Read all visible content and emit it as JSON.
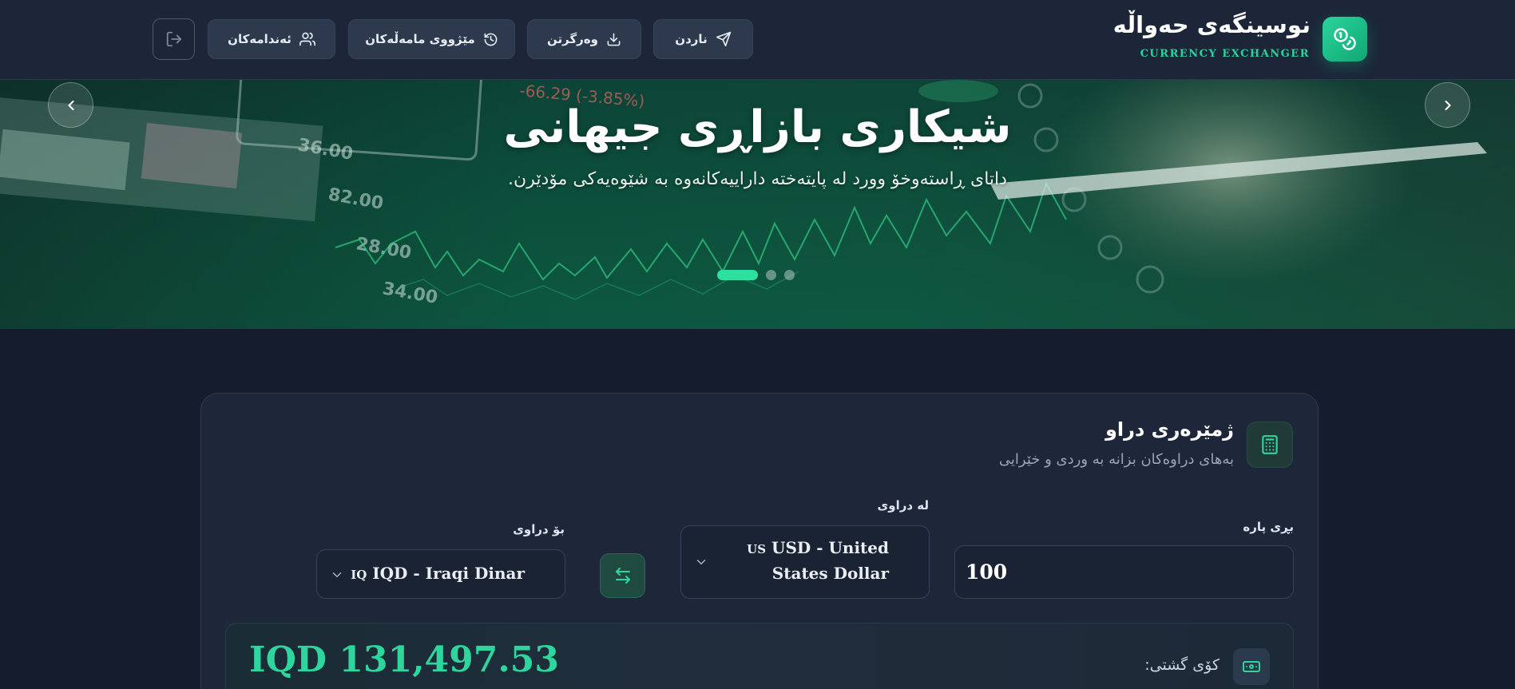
{
  "header": {
    "brand_title": "نوسینگەی حەواڵە",
    "brand_subtitle": "CURRENCY EXCHANGER",
    "nav": {
      "send": "ناردن",
      "receive": "وەرگرتن",
      "history": "مێژووی مامەڵەکان",
      "members": "ئەندامەکان"
    }
  },
  "hero": {
    "title": "شیکاری بازاڕی جیهانی",
    "subtitle": "داتای ڕاستەوخۆ وورد لە پایتەختە داراییەکانەوە بە شێوەیەکی مۆدێرن.",
    "slides": 3,
    "active_slide": 1
  },
  "converter": {
    "title": "ژمێرەری دراو",
    "subtitle": "بەهای دراوەکان بزانە بە وردی و خێرایی",
    "amount_label": "بڕی پارە",
    "amount_value": "100",
    "from_label": "لە دراوی",
    "from_code": "US",
    "from_value": "USD - United States Dollar",
    "to_label": "بۆ دراوی",
    "to_code": "IQ",
    "to_value": "IQD - Iraqi Dinar",
    "result_label": "کۆی گشتی:",
    "result_value": "IQD 131,497.53"
  },
  "colors": {
    "accent": "#2ed59c",
    "background": "#141c2e",
    "header": "#1c2638",
    "card": "#1d2739"
  },
  "icons": {
    "logo": "coins-icon",
    "send": "paper-plane-icon",
    "receive": "download-icon",
    "history": "history-icon",
    "members": "users-icon",
    "logout": "logout-icon",
    "calculator": "calculator-icon",
    "swap": "swap-arrows-icon",
    "result": "banknote-icon"
  }
}
